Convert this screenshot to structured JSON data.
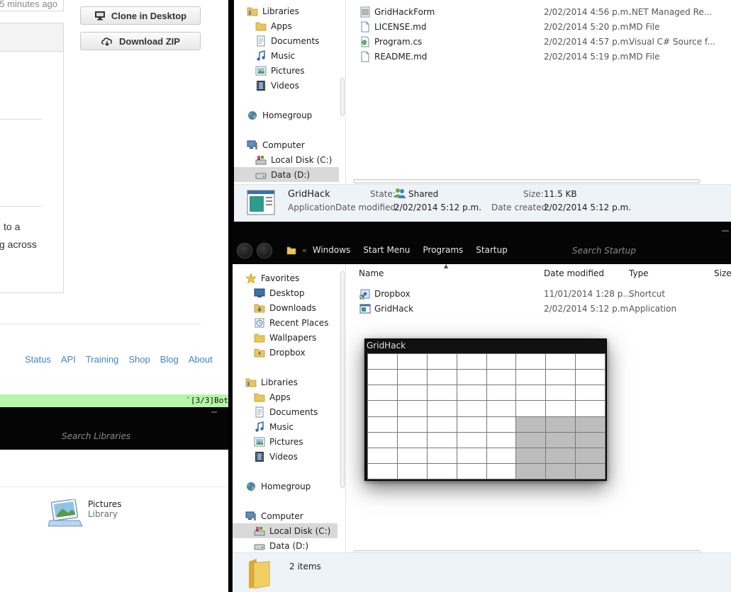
{
  "github": {
    "updated_text": "5 minutes ago",
    "clone_label": "Clone in Desktop",
    "download_label": "Download ZIP",
    "text_line1": "to a",
    "text_line2": "g across",
    "footer_links": [
      "Status",
      "API",
      "Training",
      "Shop",
      "Blog",
      "About"
    ],
    "vim_status": "`[3/3]Bot"
  },
  "library_window": {
    "search_placeholder": "Search Libraries",
    "item_name": "Pictures",
    "item_type": "Library"
  },
  "explorer_top": {
    "nav": [
      {
        "label": "Libraries",
        "icon": "libraries-icon",
        "level": "top"
      },
      {
        "label": "Apps",
        "icon": "folder-icon",
        "level": "sub"
      },
      {
        "label": "Documents",
        "icon": "documents-icon",
        "level": "sub"
      },
      {
        "label": "Music",
        "icon": "music-icon",
        "level": "sub"
      },
      {
        "label": "Pictures",
        "icon": "pictures-icon",
        "level": "sub"
      },
      {
        "label": "Videos",
        "icon": "videos-icon",
        "level": "sub"
      },
      {
        "label": "Homegroup",
        "icon": "homegroup-icon",
        "level": "top"
      },
      {
        "label": "Computer",
        "icon": "computer-icon",
        "level": "top"
      },
      {
        "label": "Local Disk (C:)",
        "icon": "disk-icon",
        "level": "sub"
      },
      {
        "label": "Data (D:)",
        "icon": "drive-icon",
        "level": "sub",
        "selected": true
      }
    ],
    "files": [
      {
        "name": "GridHackForm",
        "date": "2/02/2014 4:56 p.m.",
        "type": ".NET Managed Re...",
        "icon": "form-file-icon"
      },
      {
        "name": "LICENSE.md",
        "date": "2/02/2014 5:20 p.m.",
        "type": "MD File",
        "icon": "file-icon"
      },
      {
        "name": "Program.cs",
        "date": "2/02/2014 4:57 p.m.",
        "type": "Visual C# Source f...",
        "icon": "csharp-file-icon"
      },
      {
        "name": "README.md",
        "date": "2/02/2014 5:19 p.m.",
        "type": "MD File",
        "icon": "file-icon"
      }
    ],
    "details": {
      "name": "GridHack",
      "kind": "Application",
      "state_label": "State:",
      "state_value": "Shared",
      "size_label": "Size:",
      "size_value": "11.5 KB",
      "modified_label": "Date modified:",
      "modified_value": "2/02/2014 5:12 p.m.",
      "created_label": "Date created:",
      "created_value": "2/02/2014 5:12 p.m."
    }
  },
  "explorer_bottom": {
    "breadcrumbs": [
      "Windows",
      "Start Menu",
      "Programs",
      "Startup"
    ],
    "search_placeholder": "Search Startup",
    "columns": {
      "name": "Name",
      "date": "Date modified",
      "type": "Type",
      "size": "Size"
    },
    "nav": [
      {
        "label": "Favorites",
        "icon": "star-icon",
        "level": "top"
      },
      {
        "label": "Desktop",
        "icon": "desktop-icon",
        "level": "sub"
      },
      {
        "label": "Downloads",
        "icon": "downloads-icon",
        "level": "sub"
      },
      {
        "label": "Recent Places",
        "icon": "recent-icon",
        "level": "sub"
      },
      {
        "label": "Wallpapers",
        "icon": "folder-icon",
        "level": "sub"
      },
      {
        "label": "Dropbox",
        "icon": "dropbox-icon",
        "level": "sub"
      },
      {
        "label": "Libraries",
        "icon": "libraries-icon",
        "level": "top"
      },
      {
        "label": "Apps",
        "icon": "folder-icon",
        "level": "sub"
      },
      {
        "label": "Documents",
        "icon": "documents-icon",
        "level": "sub"
      },
      {
        "label": "Music",
        "icon": "music-icon",
        "level": "sub"
      },
      {
        "label": "Pictures",
        "icon": "pictures-icon",
        "level": "sub"
      },
      {
        "label": "Videos",
        "icon": "videos-icon",
        "level": "sub"
      },
      {
        "label": "Homegroup",
        "icon": "homegroup-icon",
        "level": "top"
      },
      {
        "label": "Computer",
        "icon": "computer-icon",
        "level": "top"
      },
      {
        "label": "Local Disk (C:)",
        "icon": "disk-icon",
        "level": "sub",
        "selected": true
      },
      {
        "label": "Data (D:)",
        "icon": "drive-icon",
        "level": "sub"
      }
    ],
    "files": [
      {
        "name": "Dropbox",
        "date": "11/01/2014 1:28 p....",
        "type": "Shortcut",
        "icon": "shortcut-icon"
      },
      {
        "name": "GridHack",
        "date": "2/02/2014 5:12 p.m.",
        "type": "Application",
        "icon": "application-icon"
      }
    ],
    "status_text": "2 items"
  },
  "gridhack_window": {
    "title": "GridHack",
    "columns": 8,
    "rows": 8,
    "selected_cells": [
      [
        4,
        5
      ],
      [
        4,
        6
      ],
      [
        4,
        7
      ],
      [
        5,
        5
      ],
      [
        5,
        6
      ],
      [
        5,
        7
      ],
      [
        6,
        5
      ],
      [
        6,
        6
      ],
      [
        6,
        7
      ],
      [
        7,
        5
      ],
      [
        7,
        6
      ],
      [
        7,
        7
      ]
    ]
  },
  "colors": {
    "link": "#4183c4",
    "selection": "#d9d9d9",
    "grid_selected": "#bdbdbd",
    "vim_bar": "#b5f5a8",
    "details_pane": "#eef3f8"
  }
}
